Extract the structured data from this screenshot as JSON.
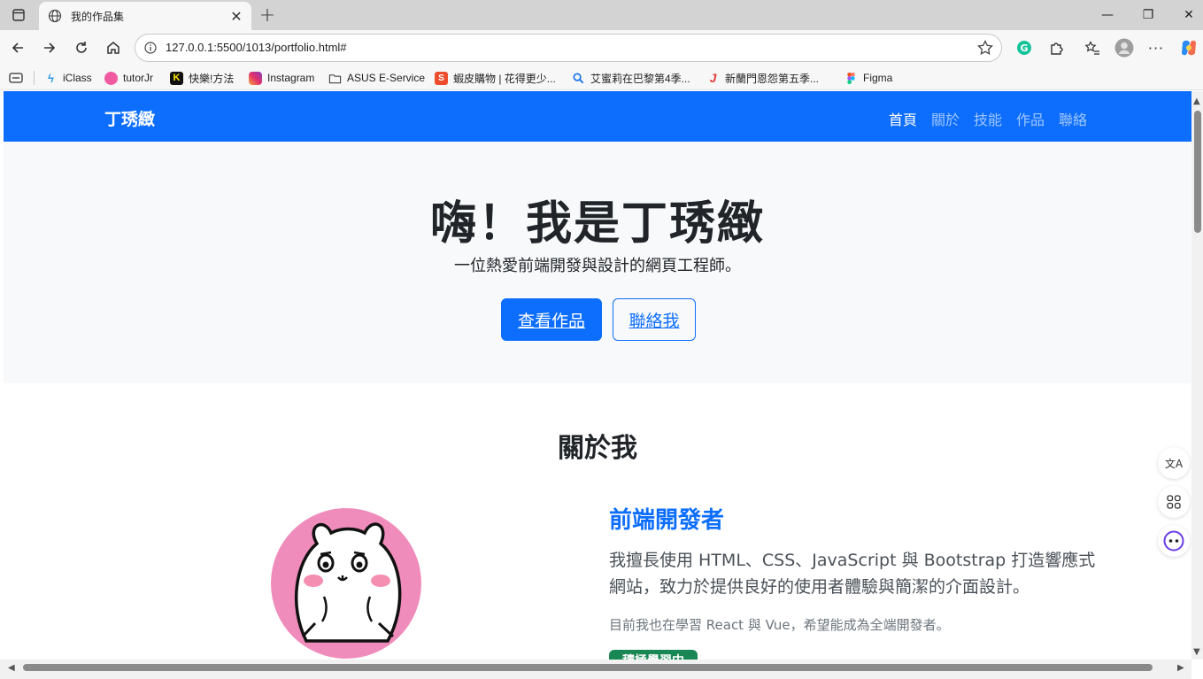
{
  "browser": {
    "tab_title": "我的作品集",
    "url": "127.0.0.1:5500/1013/portfolio.html#",
    "bookmarks": [
      {
        "label": "iClass",
        "icon": "iclass-icon",
        "color": "#2f9be0"
      },
      {
        "label": "tutorJr",
        "icon": "tutorjr-icon",
        "color": "#f15aa0"
      },
      {
        "label": "快樂!方法",
        "icon": "kuaile-icon",
        "color": "#111111"
      },
      {
        "label": "Instagram",
        "icon": "instagram-icon",
        "color": "#e1306c"
      },
      {
        "label": "ASUS E-Service",
        "icon": "folder-icon",
        "color": "#444444"
      },
      {
        "label": "蝦皮購物 | 花得更少...",
        "icon": "shopee-icon",
        "color": "#ee4d2d"
      },
      {
        "label": "艾蜜莉在巴黎第4季...",
        "icon": "search-icon",
        "color": "#1a73e8"
      },
      {
        "label": "新蘭門恩怨第五季...",
        "icon": "j-icon",
        "color": "#e53935"
      },
      {
        "label": "Figma",
        "icon": "figma-icon",
        "color": "#a259ff"
      }
    ]
  },
  "page": {
    "brand": "丁琇緻",
    "nav": [
      "首頁",
      "關於",
      "技能",
      "作品",
      "聯絡"
    ],
    "hero": {
      "title": "嗨！我是丁琇緻",
      "subtitle": "一位熱愛前端開發與設計的網頁工程師。",
      "primary_button": "查看作品",
      "secondary_button": "聯絡我"
    },
    "about": {
      "heading": "關於我",
      "role": "前端開發者",
      "description": "我擅長使用 HTML、CSS、JavaScript 與 Bootstrap 打造響應式網站，致力於提供良好的使用者體驗與簡潔的介面設計。",
      "note": "目前我也在學習 React 與 Vue，希望能成為全端開發者。",
      "badge": "積極學習中"
    }
  },
  "colors": {
    "primary": "#0d6efd",
    "hero_bg": "#f8f9fa",
    "badge": "#198754",
    "avatar_bg": "#f08cbb"
  }
}
